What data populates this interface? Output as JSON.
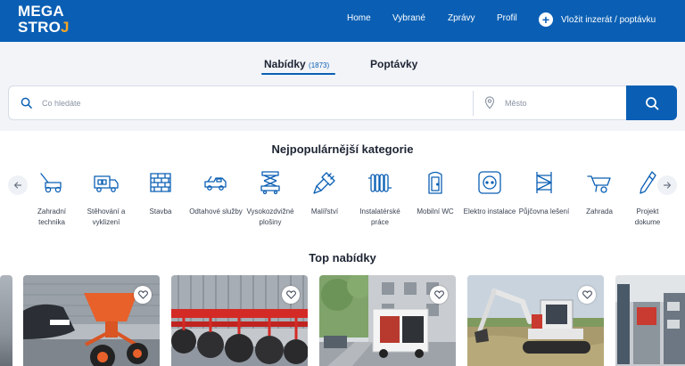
{
  "header": {
    "logo_line1": "MEGA",
    "logo_line2": "STRO",
    "logo_accent": "J",
    "nav": [
      "Home",
      "Vybrané",
      "Zprávy",
      "Profil"
    ],
    "post_label": "Vložit inzerát / poptávku",
    "post_icon": "plus-circle-icon"
  },
  "tabs": {
    "offers_label": "Nabídky",
    "offers_count": "(1873)",
    "demands_label": "Poptávky",
    "active": "offers"
  },
  "search": {
    "query_placeholder": "Co hledáte",
    "query_value": "",
    "city_placeholder": "Město",
    "city_value": ""
  },
  "categories": {
    "title": "Nejpopulárnější kategorie",
    "items": [
      {
        "label": "Zahradní technika",
        "icon": "lawnmower-icon"
      },
      {
        "label": "Stěhování a vyklizení",
        "icon": "moving-truck-icon"
      },
      {
        "label": "Stavba",
        "icon": "brick-wall-icon"
      },
      {
        "label": "Odtahové služby",
        "icon": "tow-truck-icon"
      },
      {
        "label": "Vysokozdvižné plošiny",
        "icon": "scissor-lift-icon"
      },
      {
        "label": "Malířství",
        "icon": "paint-brush-icon"
      },
      {
        "label": "Instalatérské práce",
        "icon": "radiator-icon"
      },
      {
        "label": "Mobilní WC",
        "icon": "portable-toilet-icon"
      },
      {
        "label": "Elektro instalace",
        "icon": "power-socket-icon"
      },
      {
        "label": "Půjčovna lešení",
        "icon": "scaffolding-icon"
      },
      {
        "label": "Zahrada",
        "icon": "wheelbarrow-icon"
      },
      {
        "label": "Projekt dokume",
        "icon": "blueprint-pen-icon"
      }
    ]
  },
  "top_offers": {
    "title": "Top nabídky",
    "cards": [
      {
        "image": "orange-fertilizer-spreader-photo",
        "favorite_icon": "heart-icon"
      },
      {
        "image": "red-disc-harrow-photo",
        "favorite_icon": "heart-icon"
      },
      {
        "image": "moving-van-street-photo",
        "favorite_icon": "heart-icon"
      },
      {
        "image": "mini-excavator-photo",
        "favorite_icon": "heart-icon"
      },
      {
        "image": "warehouse-machine-photo",
        "favorite_icon": "heart-icon"
      }
    ]
  },
  "colors": {
    "brand_blue": "#0a5fb4",
    "logo_accent": "#f5a623",
    "page_bg": "#f2f4f8"
  }
}
